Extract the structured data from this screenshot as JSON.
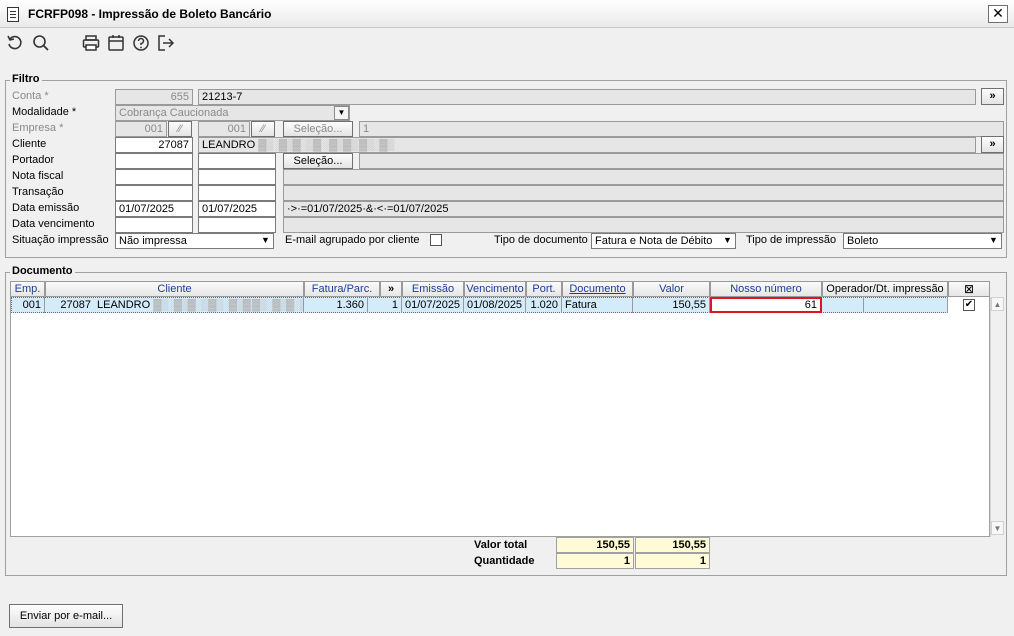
{
  "window": {
    "title": "FCRFP098 - Impressão de Boleto Bancário",
    "close_label": "✕"
  },
  "toolbar": {
    "icons": [
      "refresh-icon",
      "search-icon",
      "print-icon",
      "calendar-icon",
      "help-icon",
      "exit-icon"
    ]
  },
  "filtro": {
    "group_label": "Filtro",
    "conta": {
      "label": "Conta *",
      "code": "655",
      "desc": "21213-7",
      "more": "»"
    },
    "modalidade": {
      "label": "Modalidade *",
      "value": "Cobrança Caucionada"
    },
    "empresa": {
      "label": "Empresa *",
      "code1": "001",
      "code2": "001",
      "selecao": "Seleção...",
      "desc": "1"
    },
    "cliente": {
      "label": "Cliente",
      "code": "27087",
      "name": "LEANDRO",
      "name_blur": "▓▒░▓▒▓░▒▓ ░▓▒▓▒ ▓▒░▓▒",
      "more": "»"
    },
    "portador": {
      "label": "Portador",
      "selecao": "Seleção..."
    },
    "nota_fiscal": {
      "label": "Nota fiscal"
    },
    "transacao": {
      "label": "Transação"
    },
    "data_emissao": {
      "label": "Data emissão",
      "from": "01/07/2025",
      "to": "01/07/2025",
      "expr": "·>·=01/07/2025·&·<·=01/07/2025"
    },
    "data_vencimento": {
      "label": "Data vencimento"
    },
    "situacao": {
      "label": "Situação impressão",
      "value": "Não impressa"
    },
    "email_agrupado": {
      "label": "E-mail agrupado por cliente"
    },
    "tipo_documento": {
      "label": "Tipo de documento",
      "value": "Fatura e Nota de Débito"
    },
    "tipo_impressao": {
      "label": "Tipo de impressão",
      "value": "Boleto"
    }
  },
  "documento": {
    "group_label": "Documento",
    "headers": {
      "emp": "Emp.",
      "cliente": "Cliente",
      "fatura": "Fatura/Parc.",
      "more": "»",
      "emissao": "Emissão",
      "vencimento": "Vencimento",
      "port": "Port.",
      "documento": "Documento",
      "valor": "Valor",
      "nosso_numero": "Nosso número",
      "operador": "Operador/Dt. impressão",
      "select_all": "⊠"
    },
    "rows": [
      {
        "emp": "001",
        "cliente_code": "27087",
        "cliente_name": "LEANDRO",
        "cliente_blur": "▓▒░▓▒▓░▒▓▒░▓▒▓ ▓▒░▓▒▓░▒",
        "fatura": "1.360",
        "parc": "1",
        "emissao": "01/07/2025",
        "vencimento": "01/08/2025",
        "port": "1.020",
        "documento": "Fatura",
        "valor": "150,55",
        "nosso_numero": "61",
        "operador": "",
        "checked": "✔"
      }
    ],
    "totals": {
      "valor_total_label": "Valor total",
      "quantidade_label": "Quantidade",
      "valor_total_1": "150,55",
      "valor_total_2": "150,55",
      "quantidade_1": "1",
      "quantidade_2": "1"
    }
  },
  "footer": {
    "email_button": "Enviar por e-mail..."
  }
}
